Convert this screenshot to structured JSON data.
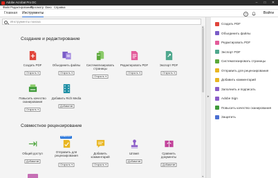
{
  "window": {
    "title": "Adobe Acrobat Pro DC",
    "controls": [
      "–",
      "□",
      "✕"
    ]
  },
  "menubar": {
    "items": [
      "Файл",
      "Редактирование",
      "Просмотр",
      "Окно",
      "Справка"
    ]
  },
  "tabs": {
    "items": [
      "Главная",
      "Инструменты"
    ],
    "active": 1
  },
  "header_right": {
    "help_icon": "question-icon",
    "bell_icon": "bell-icon",
    "login": "Войти"
  },
  "search": {
    "placeholder": "Инструменты поиска"
  },
  "sections": [
    {
      "title": "Создание и редактирование",
      "tools": [
        {
          "label": [
            "Создать PDF"
          ],
          "button": "Открыть",
          "icon": "create-pdf-icon",
          "color": "#e0443a"
        },
        {
          "label": [
            "Объединить файлы"
          ],
          "button": "Открыть",
          "icon": "combine-files-icon",
          "color": "#7a5cc7"
        },
        {
          "label": [
            "Систематизировать",
            "страницы"
          ],
          "button": "Открыть",
          "icon": "organize-pages-icon",
          "color": "#5ba83a"
        },
        {
          "label": [
            "Редактировать PDF"
          ],
          "button": "Открыть",
          "icon": "edit-pdf-icon",
          "color": "#e35b9a"
        },
        {
          "label": [
            "Экспорт PDF"
          ],
          "button": "Открыть",
          "icon": "export-pdf-icon",
          "color": "#4fa88e"
        },
        {
          "label": [
            "Повысить качество",
            "сканирования"
          ],
          "button": "Открыть",
          "icon": "enhance-scans-icon",
          "color": "#3f9a3a"
        },
        {
          "label": [
            "Добавить Rich Media"
          ],
          "button": "Добавить",
          "icon": "rich-media-icon",
          "color": "#1f8fa5"
        }
      ]
    },
    {
      "title": "Совместное рецензирование",
      "tools": [
        {
          "label": [
            "Общий доступ"
          ],
          "button": "Добавить",
          "icon": "share-icon",
          "color": "#4aa33a"
        },
        {
          "label": [
            "Отправить для",
            "рецензирования"
          ],
          "button": "Открыть",
          "icon": "send-review-icon",
          "color": "#e9b622",
          "badge": "НОВИНКА"
        },
        {
          "label": [
            "Добавить",
            "комментарий"
          ],
          "button": "Открыть",
          "icon": "comment-icon",
          "color": "#e9b622"
        },
        {
          "label": [
            "Штамп"
          ],
          "button": "Добавить",
          "icon": "stamp-icon",
          "color": "#8b5cc8"
        },
        {
          "label": [
            "Сравнить",
            "документы"
          ],
          "button": "Добавить",
          "icon": "compare-icon",
          "color": "#c2429a"
        }
      ]
    }
  ],
  "right_panel": {
    "items": [
      {
        "label": "Создать PDF",
        "icon": "create-pdf-icon",
        "color": "#e0443a"
      },
      {
        "label": "Объединить файлы",
        "icon": "combine-files-icon",
        "color": "#7a5cc7"
      },
      {
        "label": "Редактировать PDF",
        "icon": "edit-pdf-icon",
        "color": "#e35b9a"
      },
      {
        "label": "Экспорт PDF",
        "icon": "export-pdf-icon",
        "color": "#4fa88e"
      },
      {
        "label": "Систематизировать страницы",
        "icon": "organize-pages-icon",
        "color": "#5ba83a"
      },
      {
        "label": "Отправить для рецензирования",
        "icon": "send-review-icon",
        "color": "#e9b622"
      },
      {
        "label": "Добавить комментарий",
        "icon": "comment-icon",
        "color": "#e9b622"
      },
      {
        "label": "Заполнить и подписать",
        "icon": "fill-sign-icon",
        "color": "#8b5cc8"
      },
      {
        "label": "Adobe Sign",
        "icon": "adobe-sign-icon",
        "color": "#8b5cc8"
      },
      {
        "label": "Повысить качество сканирования",
        "icon": "enhance-scans-icon",
        "color": "#3f9a3a"
      },
      {
        "label": "Защитить",
        "icon": "protect-icon",
        "color": "#4a6fd1"
      }
    ]
  }
}
